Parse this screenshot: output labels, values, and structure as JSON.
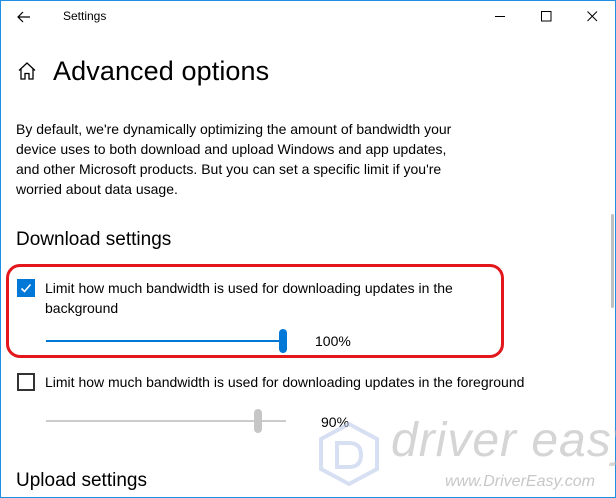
{
  "window": {
    "title": "Settings",
    "back_icon": "back-arrow-icon",
    "controls": [
      "minimize-icon",
      "maximize-icon",
      "close-icon"
    ]
  },
  "header": {
    "home_icon": "home-icon",
    "title": "Advanced options"
  },
  "description": "By default, we're dynamically optimizing the amount of bandwidth your device uses to both download and upload Windows and app updates, and other Microsoft products. But you can set a specific limit if you're worried about data usage.",
  "download_settings": {
    "heading": "Download settings",
    "background": {
      "label": "Limit how much bandwidth is used for downloading updates in the background",
      "checked": true,
      "slider_value": 100,
      "value_label": "100%"
    },
    "foreground": {
      "label": "Limit how much bandwidth is used for downloading updates in the foreground",
      "checked": false,
      "slider_value": 90,
      "value_label": "90%"
    }
  },
  "upload_settings": {
    "heading": "Upload settings"
  },
  "watermark": {
    "brand": "driver easy",
    "url": "www.DriverEasy.com"
  },
  "colors": {
    "accent": "#0078d7",
    "highlight": "#e3161b",
    "disabled_track": "#cccccc",
    "disabled_thumb": "#c6c6c6"
  }
}
